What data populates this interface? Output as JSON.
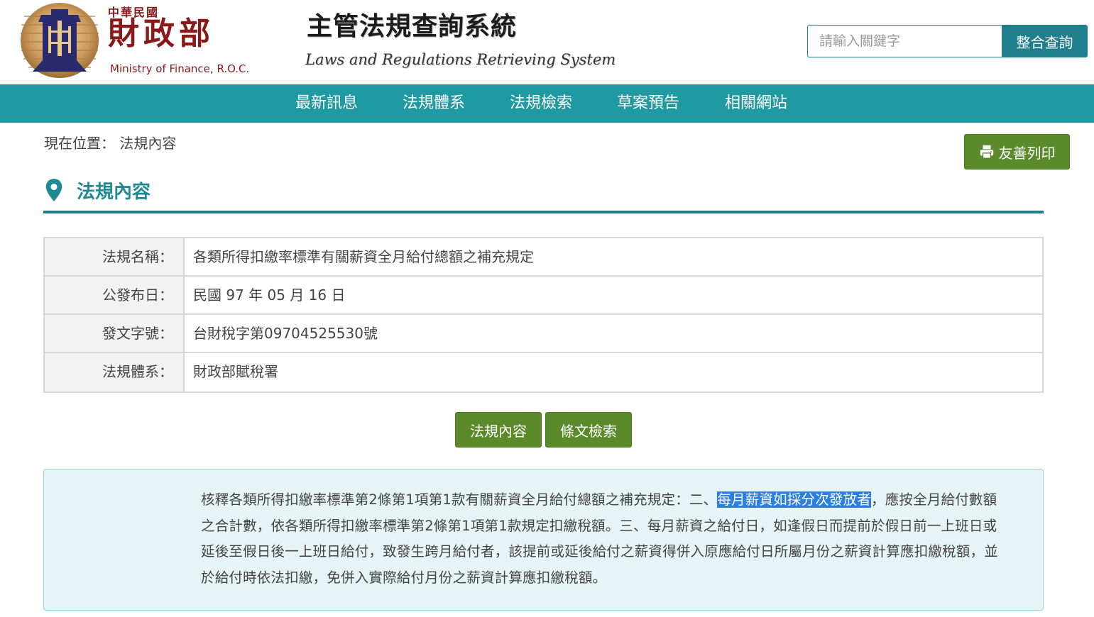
{
  "header": {
    "logo_small": "中華民國",
    "logo_big": "財政部",
    "logo_en": "Ministry of Finance, R.O.C.",
    "title": "主管法規查詢系統",
    "subtitle": "Laws and Regulations Retrieving System",
    "search_placeholder": "請輸入關鍵字",
    "search_button": "整合查詢"
  },
  "nav": {
    "items": [
      {
        "label": "最新訊息"
      },
      {
        "label": "法規體系"
      },
      {
        "label": "法規檢索"
      },
      {
        "label": "草案預告"
      },
      {
        "label": "相關網站"
      }
    ]
  },
  "breadcrumb": {
    "prefix": "現在位置：",
    "current": "法規內容"
  },
  "print_button": "友善列印",
  "section_title": "法規內容",
  "info": {
    "rows": [
      {
        "label": "法規名稱：",
        "value": "各類所得扣繳率標準有關薪資全月給付總額之補充規定"
      },
      {
        "label": "公發布日：",
        "value": "民國 97 年 05 月 16 日"
      },
      {
        "label": "發文字號：",
        "value": "台財稅字第09704525530號"
      },
      {
        "label": "法規體系：",
        "value": "財政部賦稅署"
      }
    ]
  },
  "tabs": {
    "content": "法規內容",
    "article_search": "條文檢索"
  },
  "content": {
    "before": "核釋各類所得扣繳率標準第2條第1項第1款有關薪資全月給付總額之補充規定：二、",
    "highlight": "每月薪資如採分次發放者",
    "after": "，應按全月給付數額之合計數，依各類所得扣繳率標準第2條第1項第1款規定扣繳稅額。三、每月薪資之給付日，如逢假日而提前於假日前一上班日或延後至假日後一上班日給付，致發生跨月給付者，該提前或延後給付之薪資得併入原應給付日所屬月份之薪資計算應扣繳稅額，並於給付時依法扣繳，免併入實際給付月份之薪資計算應扣繳稅額。"
  },
  "colors": {
    "nav": "#1f9aa2",
    "teal": "#1f7f8c",
    "green_button": "#5a8a2a",
    "content_bg": "#e6f4f5",
    "highlight": "#2b7fe0",
    "logo_red": "#8a1a1a"
  }
}
